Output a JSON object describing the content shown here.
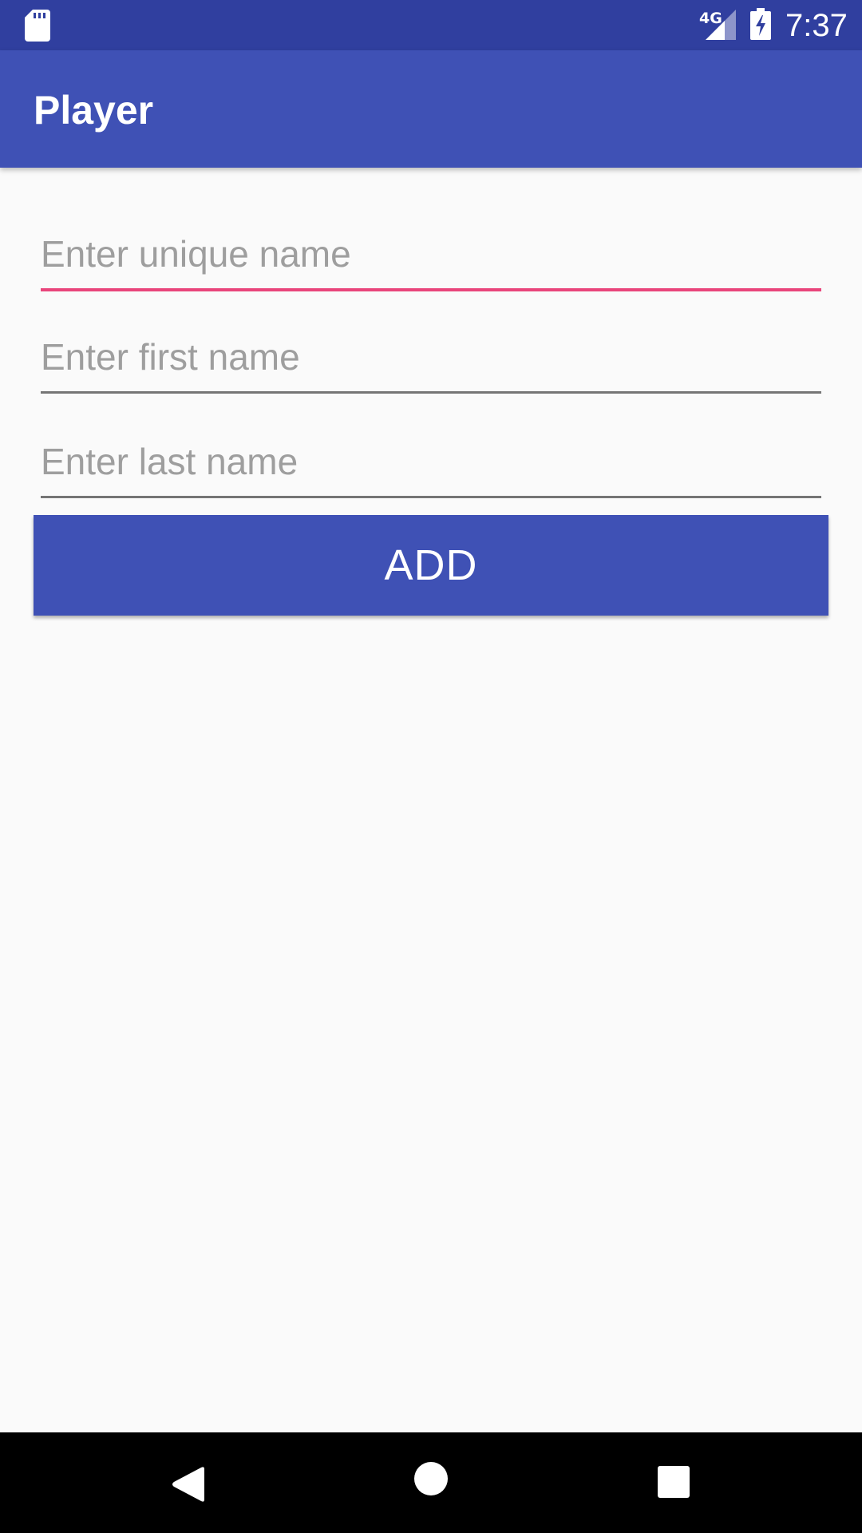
{
  "status_bar": {
    "network_label": "4G",
    "time": "7:37",
    "icons": [
      "sd-card-icon",
      "signal-icon",
      "battery-charging-icon"
    ]
  },
  "app_bar": {
    "title": "Player"
  },
  "form": {
    "unique_name": {
      "placeholder": "Enter unique name",
      "value": ""
    },
    "first_name": {
      "placeholder": "Enter first name",
      "value": ""
    },
    "last_name": {
      "placeholder": "Enter last name",
      "value": ""
    },
    "add_label": "ADD"
  },
  "nav_bar": {
    "icons": [
      "back-icon",
      "home-icon",
      "recents-icon"
    ]
  },
  "colors": {
    "primary": "#3F51B5",
    "primary_dark": "#303F9F",
    "accent": "#E9457B",
    "background": "#FAFAFA"
  }
}
